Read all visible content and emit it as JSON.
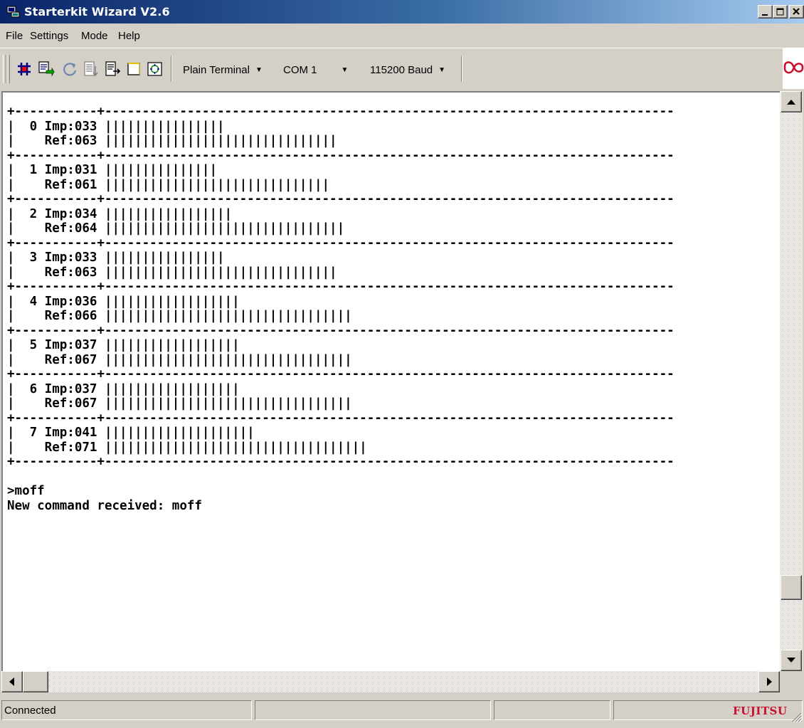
{
  "window": {
    "title": "Starterkit Wizard V2.6"
  },
  "menu": {
    "items": [
      "File",
      "Settings",
      "Mode",
      "Help"
    ]
  },
  "toolbar": {
    "icons": [
      "connect-icon",
      "download-icon",
      "reset-icon",
      "send-file-icon",
      "log-icon",
      "clear-icon",
      "options-icon"
    ],
    "mode": "Plain Terminal",
    "port": "COM 1",
    "baud": "115200 Baud"
  },
  "brand": {
    "logo": "fujitsu-infinity-logo",
    "color": "#c8102e"
  },
  "terminal": {
    "channels": [
      {
        "id": "0",
        "imp": "033",
        "ref": "063"
      },
      {
        "id": "1",
        "imp": "031",
        "ref": "061"
      },
      {
        "id": "2",
        "imp": "034",
        "ref": "064"
      },
      {
        "id": "3",
        "imp": "033",
        "ref": "063"
      },
      {
        "id": "4",
        "imp": "036",
        "ref": "066"
      },
      {
        "id": "5",
        "imp": "037",
        "ref": "067"
      },
      {
        "id": "6",
        "imp": "037",
        "ref": "067"
      },
      {
        "id": "7",
        "imp": "041",
        "ref": "071"
      }
    ],
    "command_echo": ">moff",
    "response": "New command received: moff"
  },
  "status": {
    "text": "Connected",
    "vendor": "FUJITSU"
  }
}
